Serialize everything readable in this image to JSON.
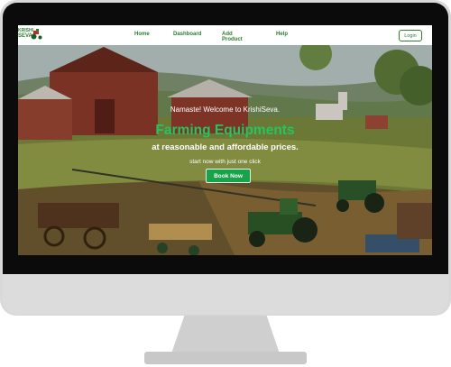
{
  "nav": {
    "logo_line1": "KRISHI",
    "logo_line2": "SEVA",
    "links": [
      "Home",
      "Dashboard",
      "Add Product",
      "Help"
    ],
    "login_label": "Login"
  },
  "hero": {
    "greeting": "Namaste! Welcome to KrishiSeva.",
    "headline": "Farming Equipments",
    "subline": "at reasonable and affordable prices.",
    "cta_text": "start now with just one click",
    "button_label": "Book Now"
  },
  "colors": {
    "brand_green": "#2e7d32",
    "headline_green": "#22c55e",
    "button_green": "#16a34a"
  },
  "icons": {
    "logo": "tractor-icon"
  }
}
